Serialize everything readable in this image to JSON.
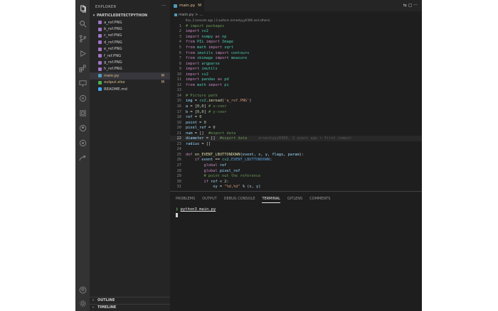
{
  "sidebar": {
    "title": "EXPLORER",
    "more": "···",
    "folder": "PARTICLEDETECTPYTHON",
    "files": [
      {
        "name": "a_ref.PNG",
        "type": "png",
        "status": ""
      },
      {
        "name": "b_ref.PNG",
        "type": "png",
        "status": ""
      },
      {
        "name": "c_ref.PNG",
        "type": "png",
        "status": ""
      },
      {
        "name": "d_ref.PNG",
        "type": "png",
        "status": ""
      },
      {
        "name": "e_ref.PNG",
        "type": "png",
        "status": ""
      },
      {
        "name": "f_ref.PNG",
        "type": "png",
        "status": ""
      },
      {
        "name": "g_ref.PNG",
        "type": "png",
        "status": ""
      },
      {
        "name": "h_ref.PNG",
        "type": "png",
        "status": ""
      },
      {
        "name": "main.py",
        "type": "py",
        "status": "M"
      },
      {
        "name": "output.xlsx",
        "type": "xlsx",
        "status": "M"
      },
      {
        "name": "README.md",
        "type": "md",
        "status": ""
      }
    ],
    "outline_label": "OUTLINE",
    "timeline_label": "TIMELINE"
  },
  "editor": {
    "tab_label": "main.py",
    "tab_status": "M",
    "tab_actions": "⇆ ▢ ···",
    "breadcrumb": "main.py > ...",
    "codelens": "Itss, 2 seconds ago | 2 authors (ernestyyy0306 and others)",
    "blame": "ernestyyy0306, 2 years ago • first commit",
    "lines": [
      {
        "n": "1",
        "code": "# import packages"
      },
      {
        "n": "2",
        "code": "import cv2"
      },
      {
        "n": "3",
        "code": "import numpy as np"
      },
      {
        "n": "4",
        "code": "from PIL import Image"
      },
      {
        "n": "5",
        "code": "from math import sqrt"
      },
      {
        "n": "6",
        "code": "from imutils import contours"
      },
      {
        "n": "7",
        "code": "from skimage import measure"
      },
      {
        "n": "8",
        "code": "import argparse"
      },
      {
        "n": "9",
        "code": "import imutils"
      },
      {
        "n": "10",
        "code": "import cv2"
      },
      {
        "n": "11",
        "code": "import pandas as pd"
      },
      {
        "n": "12",
        "code": "from math import pi"
      },
      {
        "n": "13",
        "code": ""
      },
      {
        "n": "14",
        "code": "# Picture path"
      },
      {
        "n": "15",
        "code": "img = cv2.imread('a_ref.PNG')"
      },
      {
        "n": "16",
        "code": "a = [0,0] # x-coor"
      },
      {
        "n": "17",
        "code": "b = [0,0] # y-coor"
      },
      {
        "n": "18",
        "code": "ref = 0"
      },
      {
        "n": "19",
        "code": "point = 0"
      },
      {
        "n": "20",
        "code": "pixel_ref = 0"
      },
      {
        "n": "21",
        "code": "num = []  #export data"
      },
      {
        "n": "22",
        "code": "diameter = []  #export data"
      },
      {
        "n": "23",
        "code": "radius = []"
      },
      {
        "n": "24",
        "code": ""
      },
      {
        "n": "25",
        "code": "def on_EVENT_LBUTTONDOWN(event, x, y, flags, param):"
      },
      {
        "n": "26",
        "code": "    if event == cv2.EVENT_LBUTTONDOWN:"
      },
      {
        "n": "27",
        "code": "        global ref"
      },
      {
        "n": "28",
        "code": "        global pixel_ref"
      },
      {
        "n": "29",
        "code": "        # point out the reference"
      },
      {
        "n": "30",
        "code": "        if ref < 2:"
      },
      {
        "n": "31",
        "code": "            xy = \"%d,%d\" % (x, y)"
      }
    ]
  },
  "panel": {
    "tabs": [
      "PROBLEMS",
      "OUTPUT",
      "DEBUG CONSOLE",
      "TERMINAL",
      "GITLENS",
      "COMMENTS"
    ],
    "active_tab": "TERMINAL",
    "prompt": "❯",
    "command": "python3 main.py"
  },
  "colors": {
    "window_bg": "#1e1e1e",
    "sidebar_bg": "#252526",
    "activity_bg": "#333333",
    "modified": "#e2c08d",
    "python_blue": "#519aba"
  }
}
